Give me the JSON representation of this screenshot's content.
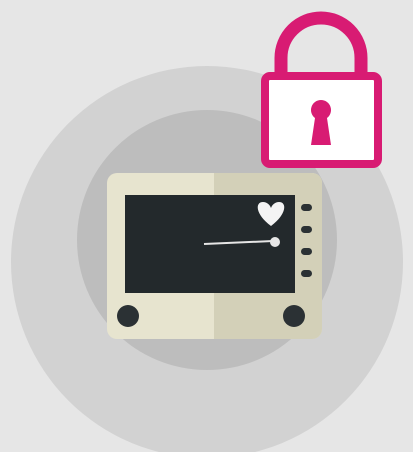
{
  "scene": {
    "background_color": "#e6e6e6",
    "outer_ring_color": "#d2d2d2",
    "inner_ring_color": "#bdbdbd"
  },
  "device": {
    "icon_name": "heart-monitor-icon",
    "body_color": "#e7e4cf",
    "body_shadow_color": "#d3d0b8",
    "screen_color": "#23292c",
    "knob_color": "#2b3134",
    "trace_color": "#e6e6e6",
    "heart_color": "#f4f4f4",
    "button_count": 4
  },
  "lock": {
    "icon_name": "padlock-icon",
    "color": "#d81b73",
    "keyhole_color": "#d81b73",
    "fill_color": "#ffffff"
  }
}
